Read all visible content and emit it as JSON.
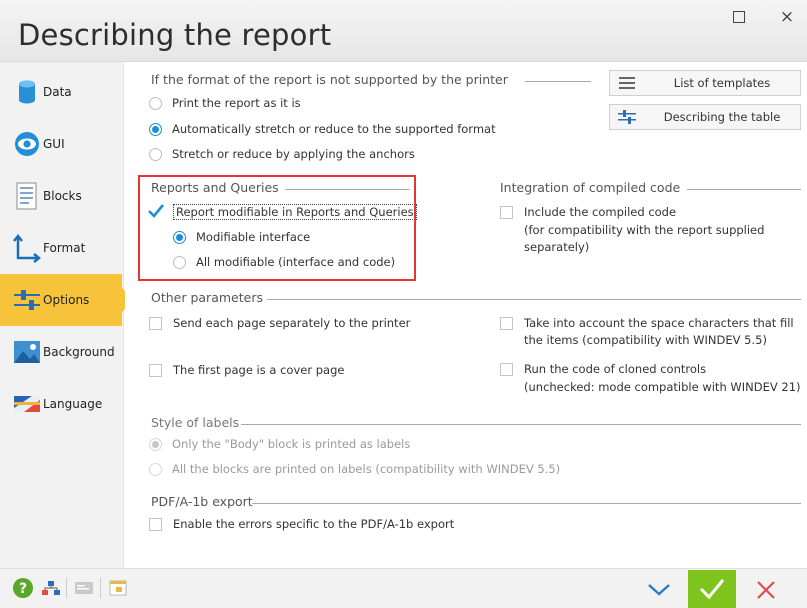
{
  "window": {
    "title": "Describing the report",
    "maximize_label": "",
    "close_label": "×"
  },
  "sidebar": {
    "items": [
      {
        "label": "Data",
        "icon": "database-icon"
      },
      {
        "label": "GUI",
        "icon": "eye-icon"
      },
      {
        "label": "Blocks",
        "icon": "blocks-document-icon"
      },
      {
        "label": "Format",
        "icon": "format-arrows-icon"
      },
      {
        "label": "Options",
        "icon": "options-sliders-icon",
        "active": true
      },
      {
        "label": "Background",
        "icon": "background-image-icon"
      },
      {
        "label": "Language",
        "icon": "language-flag-icon"
      }
    ]
  },
  "format_section": {
    "title": "If the format of the report is not supported by the printer",
    "options": [
      {
        "label": "Print the report as it is",
        "selected": false
      },
      {
        "label": "Automatically stretch or reduce to the supported format",
        "selected": true
      },
      {
        "label": "Stretch or reduce by applying the anchors",
        "selected": false
      }
    ]
  },
  "tool_buttons": {
    "templates_label": "List of templates",
    "table_label": "Describing the table"
  },
  "reports_section": {
    "title": "Reports and Queries",
    "modifiable_label": "Report modifiable in Reports and Queries",
    "modifiable_checked": true,
    "options": [
      {
        "label": "Modifiable interface",
        "selected": true
      },
      {
        "label": "All modifiable (interface and code)",
        "selected": false
      }
    ]
  },
  "compiled_section": {
    "title": "Integration of compiled code",
    "include_label": "Include the compiled code",
    "include_note_1": "(for compatibility with the report supplied",
    "include_note_2": "separately)"
  },
  "other_section": {
    "title": "Other parameters",
    "send_page_label": "Send each page separately to the printer",
    "cover_page_label": "The first page is a cover page",
    "space_chars_label_1": "Take into account the space characters that fill",
    "space_chars_label_2": "the items (compatibility with WINDEV 5.5)",
    "cloned_label_1": "Run the code of cloned controls",
    "cloned_label_2": "(unchecked: mode compatible with WINDEV 21)"
  },
  "labels_section": {
    "title": "Style of labels",
    "options": [
      {
        "label": "Only the \"Body\" block is printed as labels",
        "selected": true
      },
      {
        "label": "All the blocks are printed on labels (compatibility with WINDEV 5.5)",
        "selected": false
      }
    ]
  },
  "pdf_section": {
    "title": "PDF/A-1b export",
    "errors_label": "Enable the errors specific to the PDF/A-1b export"
  },
  "colors": {
    "accent": "#1a8ed8",
    "active_tab": "#f7c33a",
    "highlight_box": "#e53434",
    "ok_button": "#7fc41c",
    "cancel_icon": "#e04b4b"
  }
}
